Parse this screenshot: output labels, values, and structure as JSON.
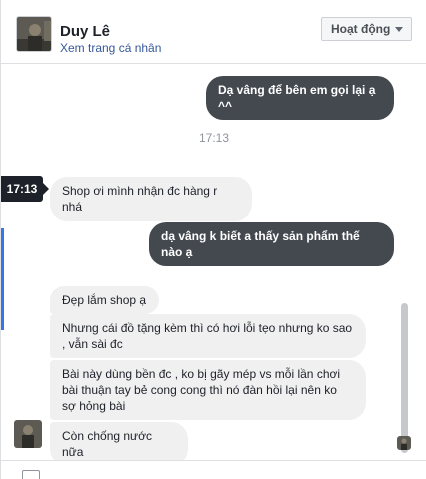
{
  "header": {
    "name": "Duy Lê",
    "profile_link": "Xem trang cá nhân",
    "status_label": "Hoạt động"
  },
  "messages": {
    "out_1": "Dạ vâng để bên em gọi lại ạ ^^",
    "timestamp_center": "17:13",
    "tooltip_time": "17:13",
    "in_1": "Shop ơi mình nhận đc hàng r nhá",
    "out_2": "dạ vâng k biết a thấy sản phẩm thế nào ạ",
    "in_2": "Đẹp lắm shop ạ",
    "in_3": "Nhưng cái đồ tặng kèm thì có hơi lỗi tẹo nhưng ko sao , vẫn sài đc",
    "in_4": "Bài này dùng bền đc , ko bị gãy mép vs mỗi lần chơi bài thuận tay bẻ cong cong thì nó đàn hồi lại nên ko sợ hỏng bài",
    "in_5": "Còn chống nước nữa"
  },
  "icons": {
    "dropdown": "chevron-down-icon",
    "composer": "camera-icon"
  },
  "colors": {
    "outgoing_bubble": "#444950",
    "incoming_bubble": "#f1f0f0",
    "link": "#365899",
    "accent": "#3578e5"
  }
}
